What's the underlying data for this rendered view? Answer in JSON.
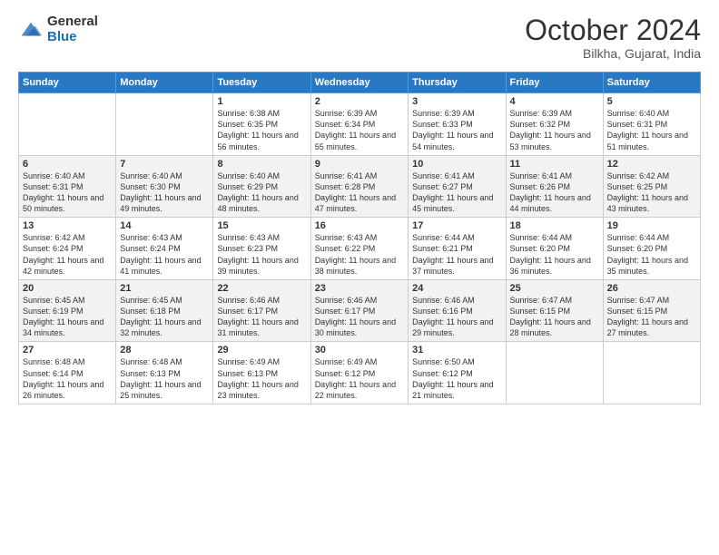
{
  "logo": {
    "general": "General",
    "blue": "Blue"
  },
  "title": "October 2024",
  "location": "Bilkha, Gujarat, India",
  "days_of_week": [
    "Sunday",
    "Monday",
    "Tuesday",
    "Wednesday",
    "Thursday",
    "Friday",
    "Saturday"
  ],
  "weeks": [
    [
      {
        "day": "",
        "sunrise": "",
        "sunset": "",
        "daylight": ""
      },
      {
        "day": "",
        "sunrise": "",
        "sunset": "",
        "daylight": ""
      },
      {
        "day": "1",
        "sunrise": "Sunrise: 6:38 AM",
        "sunset": "Sunset: 6:35 PM",
        "daylight": "Daylight: 11 hours and 56 minutes."
      },
      {
        "day": "2",
        "sunrise": "Sunrise: 6:39 AM",
        "sunset": "Sunset: 6:34 PM",
        "daylight": "Daylight: 11 hours and 55 minutes."
      },
      {
        "day": "3",
        "sunrise": "Sunrise: 6:39 AM",
        "sunset": "Sunset: 6:33 PM",
        "daylight": "Daylight: 11 hours and 54 minutes."
      },
      {
        "day": "4",
        "sunrise": "Sunrise: 6:39 AM",
        "sunset": "Sunset: 6:32 PM",
        "daylight": "Daylight: 11 hours and 53 minutes."
      },
      {
        "day": "5",
        "sunrise": "Sunrise: 6:40 AM",
        "sunset": "Sunset: 6:31 PM",
        "daylight": "Daylight: 11 hours and 51 minutes."
      }
    ],
    [
      {
        "day": "6",
        "sunrise": "Sunrise: 6:40 AM",
        "sunset": "Sunset: 6:31 PM",
        "daylight": "Daylight: 11 hours and 50 minutes."
      },
      {
        "day": "7",
        "sunrise": "Sunrise: 6:40 AM",
        "sunset": "Sunset: 6:30 PM",
        "daylight": "Daylight: 11 hours and 49 minutes."
      },
      {
        "day": "8",
        "sunrise": "Sunrise: 6:40 AM",
        "sunset": "Sunset: 6:29 PM",
        "daylight": "Daylight: 11 hours and 48 minutes."
      },
      {
        "day": "9",
        "sunrise": "Sunrise: 6:41 AM",
        "sunset": "Sunset: 6:28 PM",
        "daylight": "Daylight: 11 hours and 47 minutes."
      },
      {
        "day": "10",
        "sunrise": "Sunrise: 6:41 AM",
        "sunset": "Sunset: 6:27 PM",
        "daylight": "Daylight: 11 hours and 45 minutes."
      },
      {
        "day": "11",
        "sunrise": "Sunrise: 6:41 AM",
        "sunset": "Sunset: 6:26 PM",
        "daylight": "Daylight: 11 hours and 44 minutes."
      },
      {
        "day": "12",
        "sunrise": "Sunrise: 6:42 AM",
        "sunset": "Sunset: 6:25 PM",
        "daylight": "Daylight: 11 hours and 43 minutes."
      }
    ],
    [
      {
        "day": "13",
        "sunrise": "Sunrise: 6:42 AM",
        "sunset": "Sunset: 6:24 PM",
        "daylight": "Daylight: 11 hours and 42 minutes."
      },
      {
        "day": "14",
        "sunrise": "Sunrise: 6:43 AM",
        "sunset": "Sunset: 6:24 PM",
        "daylight": "Daylight: 11 hours and 41 minutes."
      },
      {
        "day": "15",
        "sunrise": "Sunrise: 6:43 AM",
        "sunset": "Sunset: 6:23 PM",
        "daylight": "Daylight: 11 hours and 39 minutes."
      },
      {
        "day": "16",
        "sunrise": "Sunrise: 6:43 AM",
        "sunset": "Sunset: 6:22 PM",
        "daylight": "Daylight: 11 hours and 38 minutes."
      },
      {
        "day": "17",
        "sunrise": "Sunrise: 6:44 AM",
        "sunset": "Sunset: 6:21 PM",
        "daylight": "Daylight: 11 hours and 37 minutes."
      },
      {
        "day": "18",
        "sunrise": "Sunrise: 6:44 AM",
        "sunset": "Sunset: 6:20 PM",
        "daylight": "Daylight: 11 hours and 36 minutes."
      },
      {
        "day": "19",
        "sunrise": "Sunrise: 6:44 AM",
        "sunset": "Sunset: 6:20 PM",
        "daylight": "Daylight: 11 hours and 35 minutes."
      }
    ],
    [
      {
        "day": "20",
        "sunrise": "Sunrise: 6:45 AM",
        "sunset": "Sunset: 6:19 PM",
        "daylight": "Daylight: 11 hours and 34 minutes."
      },
      {
        "day": "21",
        "sunrise": "Sunrise: 6:45 AM",
        "sunset": "Sunset: 6:18 PM",
        "daylight": "Daylight: 11 hours and 32 minutes."
      },
      {
        "day": "22",
        "sunrise": "Sunrise: 6:46 AM",
        "sunset": "Sunset: 6:17 PM",
        "daylight": "Daylight: 11 hours and 31 minutes."
      },
      {
        "day": "23",
        "sunrise": "Sunrise: 6:46 AM",
        "sunset": "Sunset: 6:17 PM",
        "daylight": "Daylight: 11 hours and 30 minutes."
      },
      {
        "day": "24",
        "sunrise": "Sunrise: 6:46 AM",
        "sunset": "Sunset: 6:16 PM",
        "daylight": "Daylight: 11 hours and 29 minutes."
      },
      {
        "day": "25",
        "sunrise": "Sunrise: 6:47 AM",
        "sunset": "Sunset: 6:15 PM",
        "daylight": "Daylight: 11 hours and 28 minutes."
      },
      {
        "day": "26",
        "sunrise": "Sunrise: 6:47 AM",
        "sunset": "Sunset: 6:15 PM",
        "daylight": "Daylight: 11 hours and 27 minutes."
      }
    ],
    [
      {
        "day": "27",
        "sunrise": "Sunrise: 6:48 AM",
        "sunset": "Sunset: 6:14 PM",
        "daylight": "Daylight: 11 hours and 26 minutes."
      },
      {
        "day": "28",
        "sunrise": "Sunrise: 6:48 AM",
        "sunset": "Sunset: 6:13 PM",
        "daylight": "Daylight: 11 hours and 25 minutes."
      },
      {
        "day": "29",
        "sunrise": "Sunrise: 6:49 AM",
        "sunset": "Sunset: 6:13 PM",
        "daylight": "Daylight: 11 hours and 23 minutes."
      },
      {
        "day": "30",
        "sunrise": "Sunrise: 6:49 AM",
        "sunset": "Sunset: 6:12 PM",
        "daylight": "Daylight: 11 hours and 22 minutes."
      },
      {
        "day": "31",
        "sunrise": "Sunrise: 6:50 AM",
        "sunset": "Sunset: 6:12 PM",
        "daylight": "Daylight: 11 hours and 21 minutes."
      },
      {
        "day": "",
        "sunrise": "",
        "sunset": "",
        "daylight": ""
      },
      {
        "day": "",
        "sunrise": "",
        "sunset": "",
        "daylight": ""
      }
    ]
  ]
}
